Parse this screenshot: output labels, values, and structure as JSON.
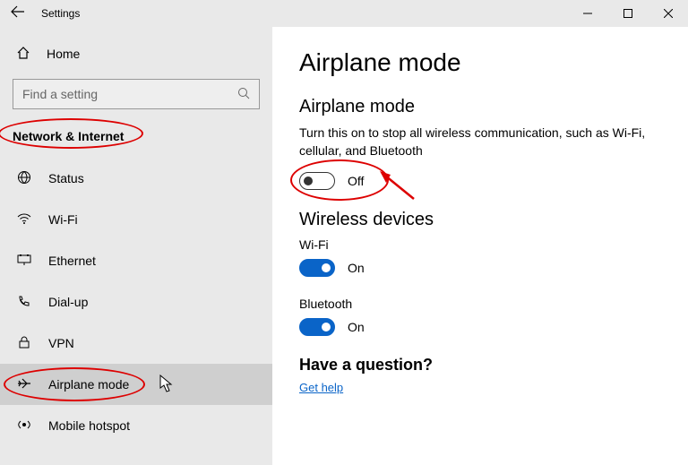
{
  "titlebar": {
    "title": "Settings"
  },
  "home_label": "Home",
  "search": {
    "placeholder": "Find a setting"
  },
  "category": "Network & Internet",
  "nav": {
    "items": [
      {
        "label": "Status"
      },
      {
        "label": "Wi-Fi"
      },
      {
        "label": "Ethernet"
      },
      {
        "label": "Dial-up"
      },
      {
        "label": "VPN"
      },
      {
        "label": "Airplane mode"
      },
      {
        "label": "Mobile hotspot"
      }
    ]
  },
  "main": {
    "heading": "Airplane mode",
    "section1": {
      "title": "Airplane mode",
      "desc": "Turn this on to stop all wireless communication, such as Wi-Fi, cellular, and Bluetooth",
      "toggle_state": "Off"
    },
    "section2": {
      "title": "Wireless devices",
      "wifi_label": "Wi-Fi",
      "wifi_state": "On",
      "bt_label": "Bluetooth",
      "bt_state": "On"
    },
    "question": {
      "title": "Have a question?",
      "link": "Get help"
    }
  }
}
